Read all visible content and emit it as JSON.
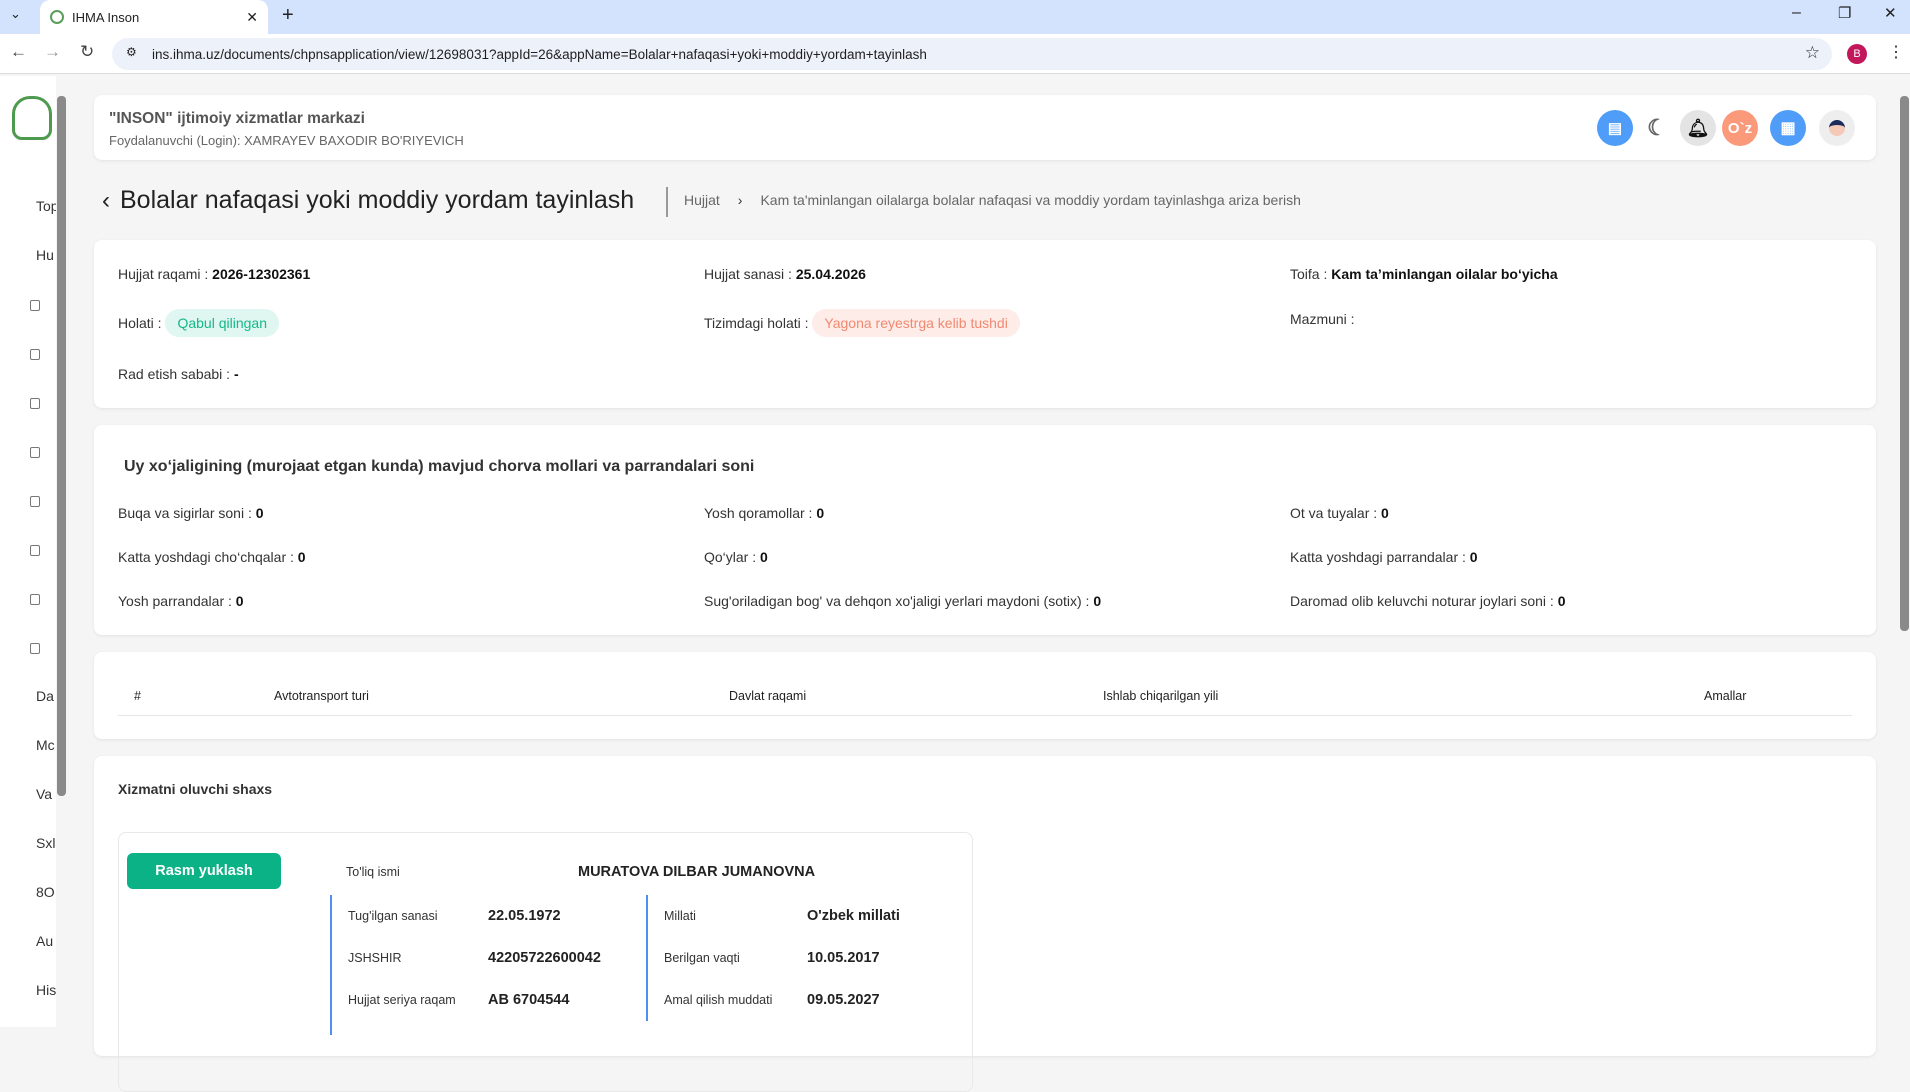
{
  "browser": {
    "tab_title": "IHMA Inson",
    "url": "ins.ihma.uz/documents/chpnsapplication/view/12698031?appId=26&appName=Bolalar+nafaqasi+yoki+moddiy+yordam+tayinlash",
    "profile_initial": "B"
  },
  "sidebar": {
    "items": [
      "Top",
      "Hu",
      "",
      "",
      "",
      "",
      "",
      "",
      "",
      "",
      "Da",
      "Mc",
      "Va",
      "Sxl",
      "8O",
      "Au",
      "His"
    ]
  },
  "header": {
    "org": "\"INSON\" ijtimoiy xizmatlar markazi",
    "user": "Foydalanuvchi (Login): XAMRAYEV BAXODIR BO'RIYEVICH",
    "lang": "O`z",
    "icons": [
      "document-check-icon",
      "moon-icon",
      "bell-icon",
      "language-icon",
      "apps-icon",
      "avatar-icon"
    ]
  },
  "page": {
    "title": "Bolalar nafaqasi yoki moddiy yordam tayinlash",
    "breadcrumb": [
      "Hujjat",
      "Kam ta'minlangan oilalarga bolalar nafaqasi va moddiy yordam tayinlashga ariza berish"
    ]
  },
  "doc": {
    "number_label": "Hujjat raqami :",
    "number": "2026-12302361",
    "date_label": "Hujjat sanasi :",
    "date": "25.04.2026",
    "category_label": "Toifa :",
    "category": "Kam ta’minlangan oilalar bo‘yicha",
    "status_label": "Holati :",
    "status": "Qabul qilingan",
    "system_status_label": "Tizimdagi holati :",
    "system_status": "Yagona reyestrga kelib tushdi",
    "content_label": "Mazmuni :",
    "reject_label": "Rad etish sababi :",
    "reject": "-",
    "colors": {
      "status_bg": "#e0f6f0",
      "status_fg": "#14b88a",
      "system_bg": "#fdece8",
      "system_fg": "#f2896f"
    }
  },
  "livestock": {
    "title": "Uy xo‘jaligining (murojaat etgan kunda) mavjud chorva mollari va parrandalari soni",
    "items": [
      {
        "label": "Buqa va sigirlar soni :",
        "value": "0"
      },
      {
        "label": "Yosh qoramollar :",
        "value": "0"
      },
      {
        "label": "Ot va tuyalar :",
        "value": "0"
      },
      {
        "label": "Katta yoshdagi cho‘chqalar :",
        "value": "0"
      },
      {
        "label": "Qo‘ylar :",
        "value": "0"
      },
      {
        "label": "Katta yoshdagi parrandalar :",
        "value": "0"
      },
      {
        "label": "Yosh parrandalar :",
        "value": "0"
      },
      {
        "label": "Sug'oriladigan bog' va dehqon xo'jaligi yerlari maydoni (sotix) :",
        "value": "0"
      },
      {
        "label": "Daromad olib keluvchi noturar joylari soni :",
        "value": "0"
      }
    ]
  },
  "vehicles": {
    "columns": [
      "#",
      "Avtotransport turi",
      "Davlat raqami",
      "Ishlab chiqarilgan yili",
      "Amallar"
    ],
    "rows": []
  },
  "person": {
    "title": "Xizmatni oluvchi shaxs",
    "upload_button": "Rasm yuklash",
    "accent": "#0ab286",
    "fullname_label": "To'liq ismi",
    "fullname": "MURATOVA DILBAR JUMANOVNA",
    "left": [
      {
        "label": "Tug'ilgan sanasi",
        "value": "22.05.1972"
      },
      {
        "label": "JSHSHIR",
        "value": "42205722600042"
      },
      {
        "label": "Hujjat seriya raqam",
        "value": "AB 6704544"
      }
    ],
    "right": [
      {
        "label": "Millati",
        "value": "O'zbek millati"
      },
      {
        "label": "Berilgan vaqti",
        "value": "10.05.2017"
      },
      {
        "label": "Amal qilish muddati",
        "value": "09.05.2027"
      }
    ]
  }
}
